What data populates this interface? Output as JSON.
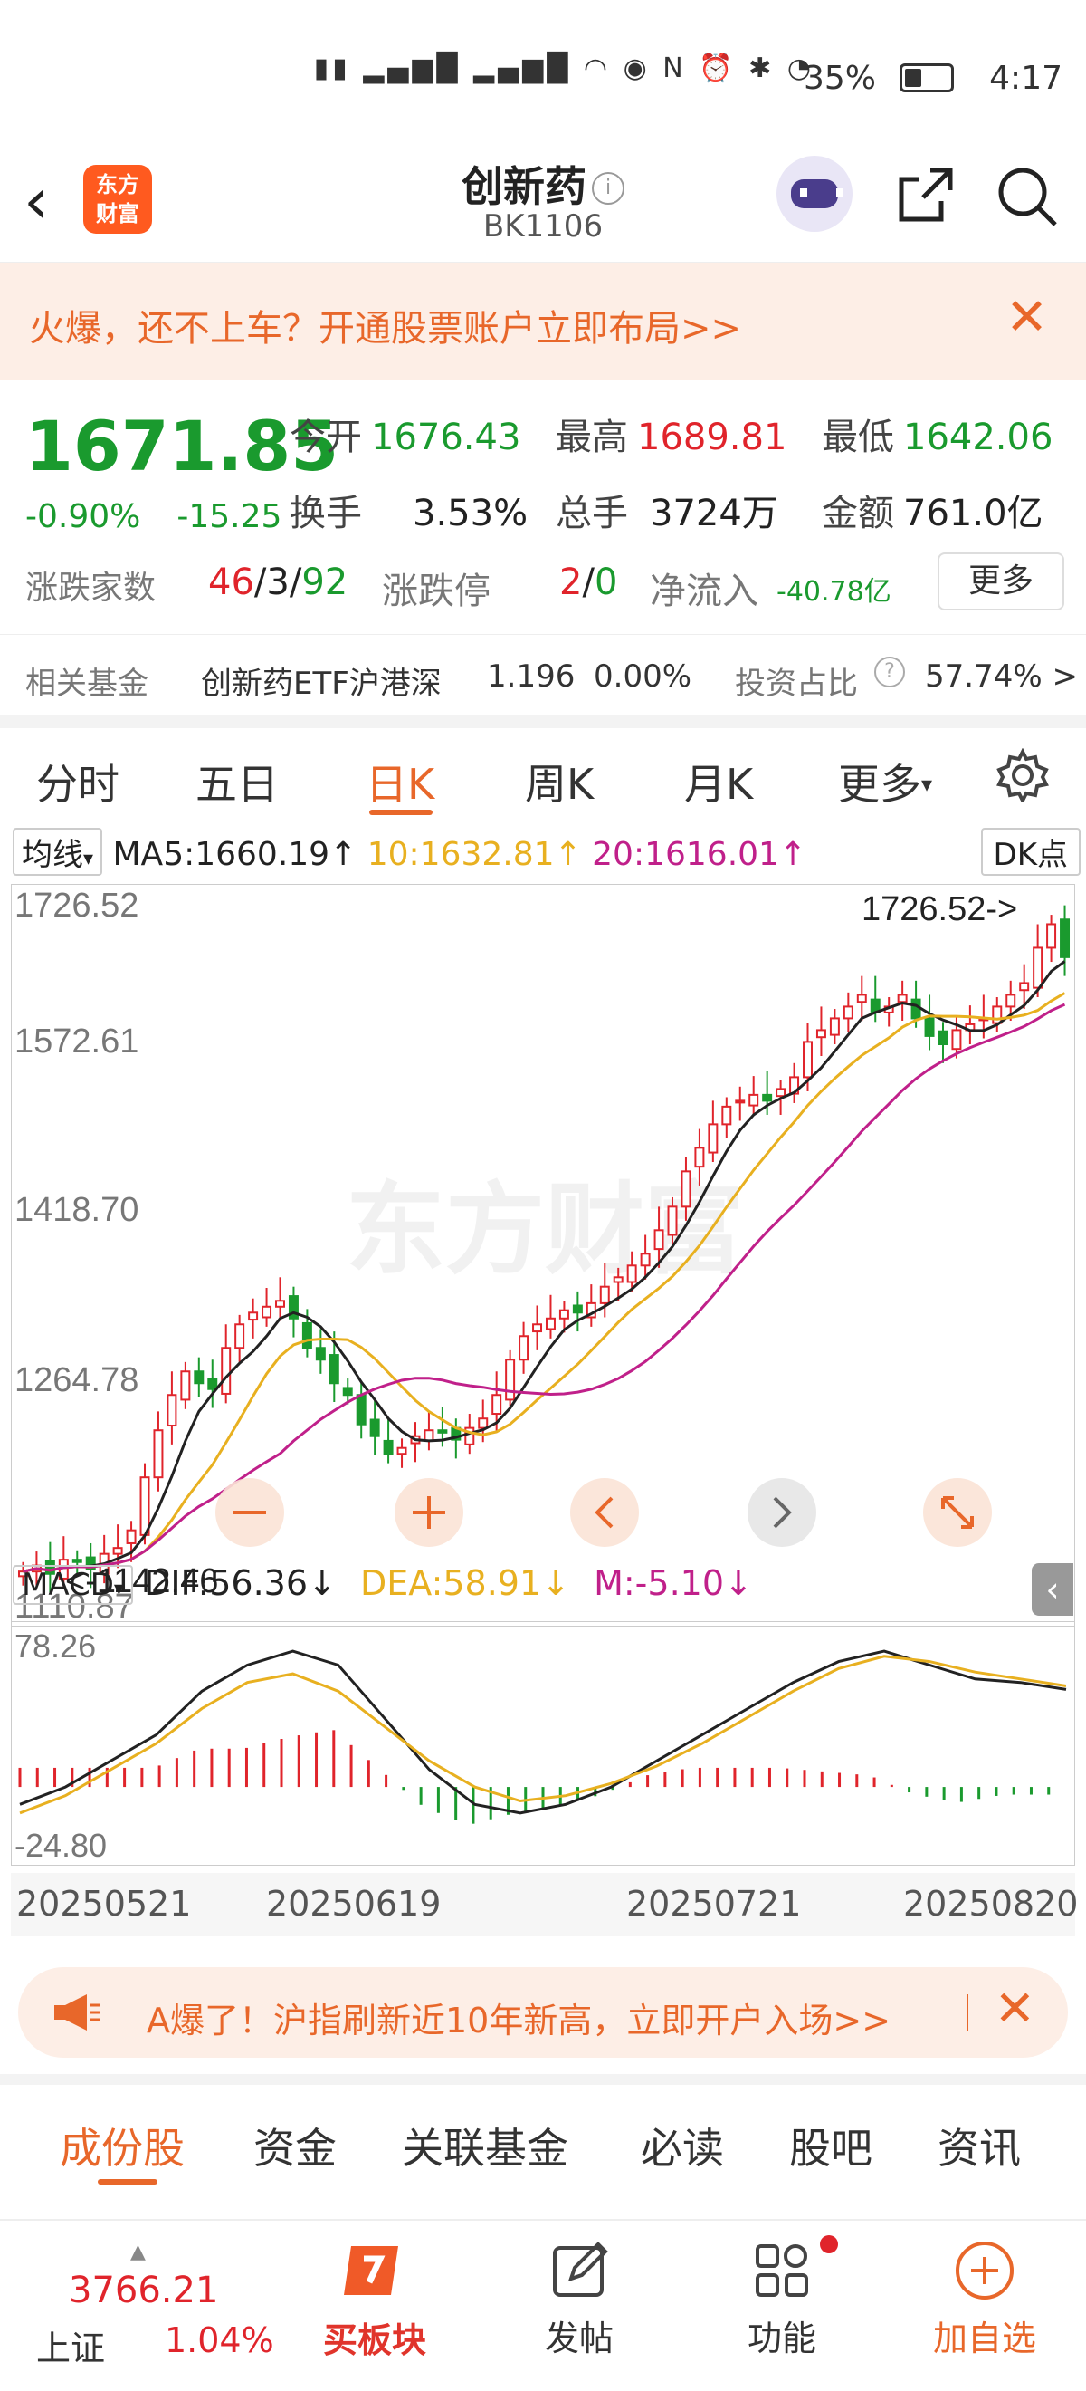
{
  "status_bar": {
    "battery": "35%",
    "time": "4:17"
  },
  "header": {
    "title": "创新药",
    "code": "BK1106",
    "logo_text": "东方财富"
  },
  "promo_banner": {
    "text": "火爆，还不上车？开通股票账户立即布局>>"
  },
  "quote": {
    "price": "1671.85",
    "change_pct": "-0.90%",
    "change": "-15.25",
    "open_label": "今开",
    "open": "1676.43",
    "high_label": "最高",
    "high": "1689.81",
    "low_label": "最低",
    "low": "1642.06",
    "turnover_label": "换手",
    "turnover": "3.53%",
    "volume_label": "总手",
    "volume": "3724万",
    "amount_label": "金额",
    "amount": "761.0亿",
    "breadth_label": "涨跌家数",
    "breadth_up": "46",
    "breadth_flat": "3",
    "breadth_down": "92",
    "limit_label": "涨跌停",
    "limit_up": "2",
    "limit_down": "0",
    "netflow_label": "净流入",
    "netflow": "-40.78亿",
    "more_button": "更多",
    "fund_label": "相关基金",
    "fund_name": "创新药ETF沪港深",
    "fund_price": "1.196",
    "fund_chg": "0.00%",
    "ratio_label": "投资占比",
    "ratio": "57.74% >"
  },
  "tabs": [
    "分时",
    "五日",
    "日K",
    "周K",
    "月K",
    "更多"
  ],
  "legend": {
    "ma_label": "均线",
    "ma5": "MA5:1660.19↑",
    "ma10": "10:1632.81↑",
    "ma20": "20:1616.01↑",
    "dk": "DK点",
    "macd_label": "MACD",
    "dif": "DIF:56.36↓",
    "dea": "DEA:58.91↓",
    "m": "M:-5.10↓"
  },
  "axis": {
    "y_labels": [
      "1726.52",
      "1572.61",
      "1418.70",
      "1264.78",
      "1110.87"
    ],
    "macd_labels": [
      "78.26",
      "-24.80"
    ],
    "dates": [
      "20250521",
      "20250619",
      "20250721",
      "20250820"
    ],
    "high_marker": "1726.52->",
    "low_marker": "<-1142.46"
  },
  "colors": {
    "up": "#e0242b",
    "down": "#1a9a2e",
    "ma5": "#222222",
    "ma10": "#e8b020",
    "ma20": "#c0208a",
    "accent": "#e8672a"
  },
  "chart_data": {
    "type": "candlestick",
    "ylim": [
      1110.87,
      1726.52
    ],
    "closes": [
      1150,
      1155,
      1148,
      1160,
      1158,
      1152,
      1165,
      1170,
      1185,
      1230,
      1270,
      1300,
      1320,
      1310,
      1305,
      1340,
      1360,
      1370,
      1375,
      1380,
      1365,
      1340,
      1330,
      1310,
      1300,
      1275,
      1265,
      1250,
      1255,
      1265,
      1270,
      1268,
      1262,
      1272,
      1280,
      1300,
      1330,
      1350,
      1360,
      1365,
      1372,
      1370,
      1378,
      1392,
      1400,
      1410,
      1420,
      1440,
      1460,
      1490,
      1510,
      1530,
      1545,
      1550,
      1555,
      1550,
      1560,
      1570,
      1600,
      1610,
      1620,
      1630,
      1640,
      1625,
      1630,
      1640,
      1620,
      1605,
      1598,
      1610,
      1615,
      1620,
      1630,
      1640,
      1650,
      1680,
      1700,
      1672
    ],
    "macd_dif": [
      -10,
      0,
      15,
      30,
      55,
      70,
      78,
      70,
      40,
      10,
      -10,
      -15,
      -10,
      0,
      15,
      30,
      45,
      60,
      72,
      78,
      70,
      62,
      60,
      56
    ],
    "macd_dea": [
      -15,
      -5,
      10,
      25,
      45,
      60,
      65,
      55,
      35,
      15,
      0,
      -8,
      -5,
      2,
      12,
      25,
      40,
      55,
      68,
      75,
      72,
      66,
      62,
      58
    ]
  },
  "ad_banner": {
    "text": "A爆了！沪指刷新近10年新高，立即开户入场>>"
  },
  "sub_tabs": [
    "成份股",
    "资金",
    "关联基金",
    "必读",
    "股吧",
    "资讯"
  ],
  "bottom_bar": {
    "index_value": "3766.21",
    "index_name": "上证",
    "index_chg": "1.04%",
    "buy_label": "买板块",
    "post_label": "发帖",
    "func_label": "功能",
    "add_label": "加自选"
  }
}
